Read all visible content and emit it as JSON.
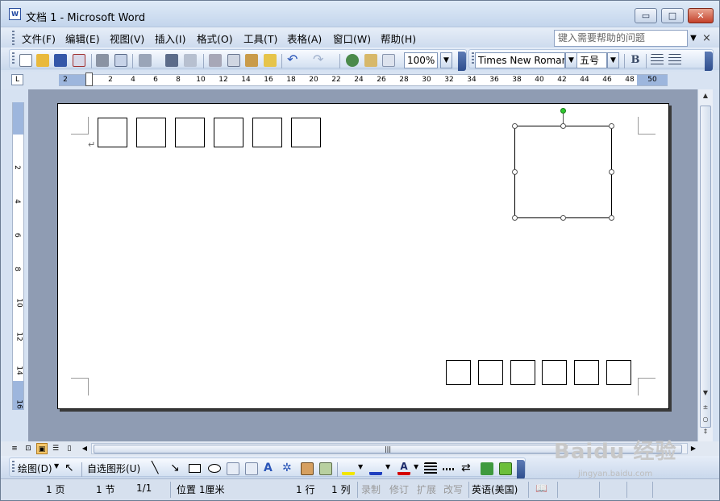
{
  "window": {
    "app_icon_text": "W",
    "title": "文档 1 - Microsoft Word",
    "controls": {
      "minimize": "▭",
      "maximize": "□",
      "close": "✕"
    }
  },
  "menubar": {
    "items": [
      "文件(F)",
      "编辑(E)",
      "视图(V)",
      "插入(I)",
      "格式(O)",
      "工具(T)",
      "表格(A)",
      "窗口(W)",
      "帮助(H)"
    ],
    "help_placeholder": "键入需要帮助的问题",
    "close_doc": "×"
  },
  "standard_toolbar": {
    "zoom": "100%",
    "font_name": "Times New Roman",
    "font_size": "五号",
    "bold": "B"
  },
  "icons": [
    "new-document-icon",
    "open-icon",
    "save-icon",
    "permission-icon",
    "print-icon",
    "print-preview-icon",
    "research-icon",
    "spelling-icon",
    "translate-icon",
    "cut-icon",
    "copy-icon",
    "paste-icon",
    "format-painter-icon",
    "undo-icon",
    "redo-icon",
    "hyperlink-icon",
    "tables-borders-icon",
    "insert-table-icon",
    "align-left-icon",
    "center-icon"
  ],
  "ruler": {
    "corner": "L",
    "labels": [
      "2",
      "",
      "2",
      "4",
      "6",
      "8",
      "10",
      "12",
      "14",
      "16",
      "18",
      "20",
      "22",
      "24",
      "26",
      "28",
      "30",
      "32",
      "34",
      "36",
      "38",
      "40",
      "42",
      "44",
      "46",
      "48",
      "50"
    ],
    "vertical_labels": [
      "2",
      "4",
      "6",
      "8",
      "10",
      "12",
      "14",
      "16"
    ]
  },
  "document": {
    "paragraph_mark": "↵"
  },
  "scroll": {
    "up": "▲",
    "down": "▼",
    "prev": "±",
    "select": "○",
    "next": "‡",
    "left": "◀",
    "right": "▶",
    "thumb": "|||"
  },
  "views": {
    "normal": "≡",
    "web": "⊡",
    "print": "▣",
    "outline": "☰",
    "reading": "▯"
  },
  "drawing_toolbar": {
    "draw_label": "绘图(D)",
    "autoshapes_label": "自选图形(U)"
  },
  "statusbar": {
    "page": "1 页",
    "section": "1 节",
    "page_of": "1/1",
    "position": "位置 1厘米",
    "line": "1 行",
    "column": "1 列",
    "rec": "录制",
    "trk": "修订",
    "ext": "扩展",
    "ovr": "改写",
    "language": "英语(美国)"
  },
  "watermark": {
    "main": "Baidu 经验",
    "sub": "jingyan.baidu.com"
  },
  "colors": {
    "highlight": "#f2e600",
    "line_color": "#1f3fbf",
    "font_color": "#d40000",
    "rotate_handle": "#2fc82f"
  }
}
